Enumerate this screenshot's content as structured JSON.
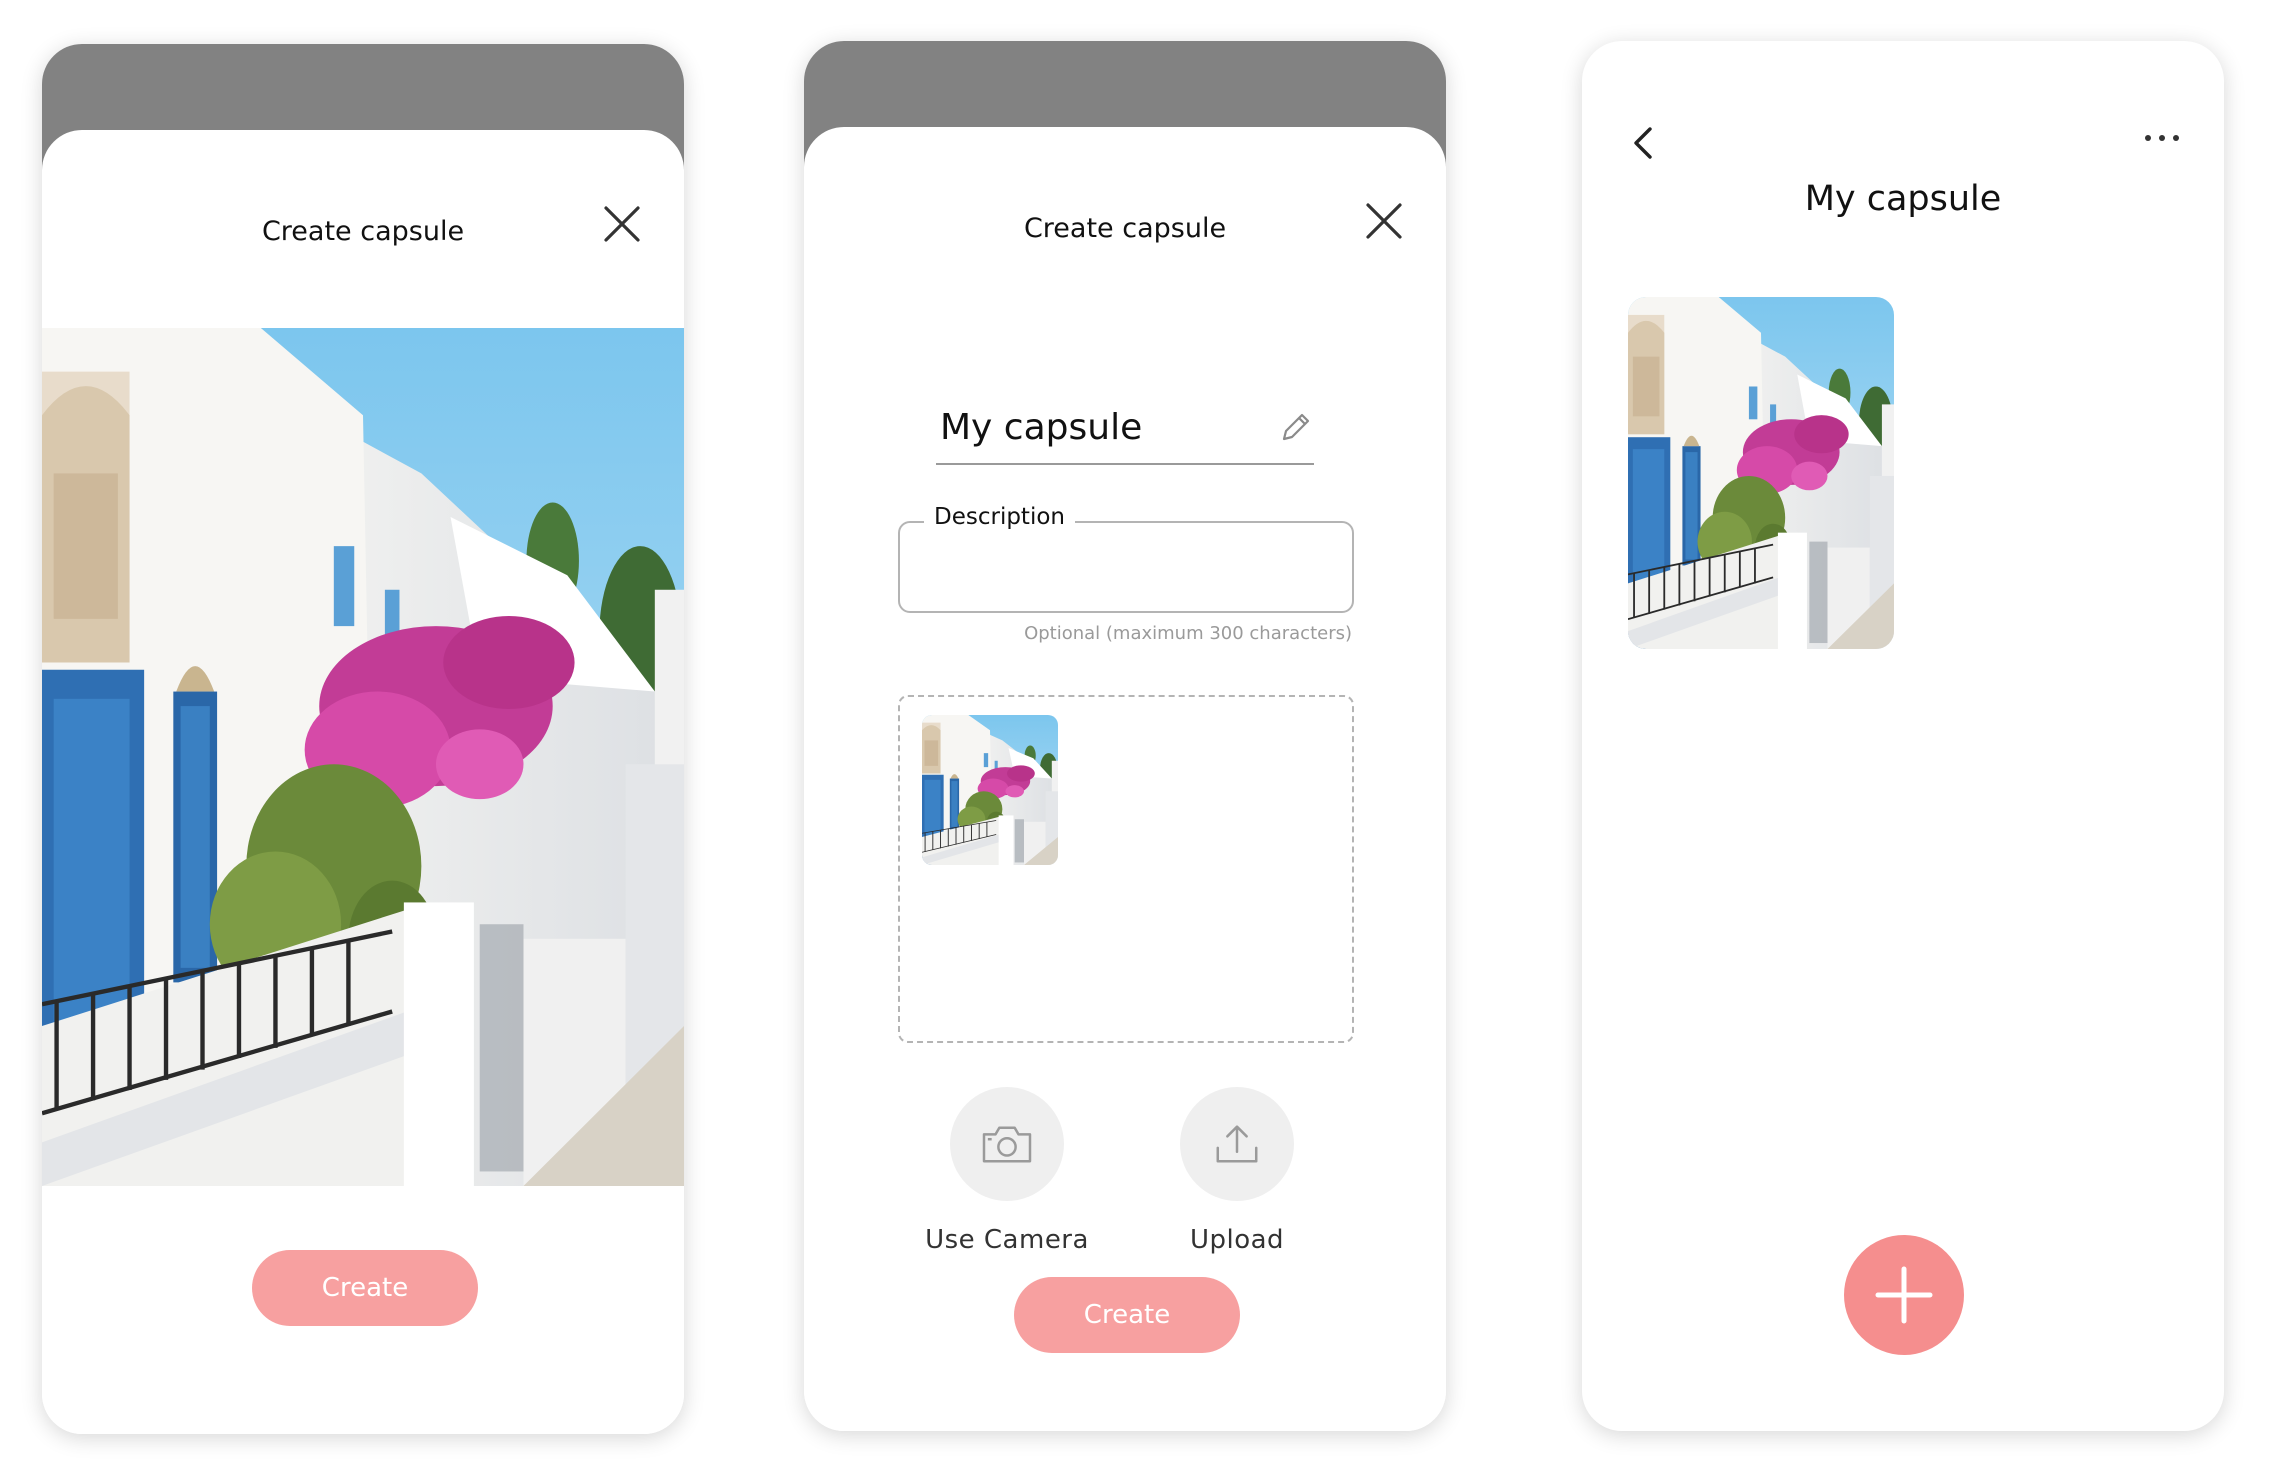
{
  "create_sheet": {
    "title": "Create capsule",
    "create_label": "Create"
  },
  "details_sheet": {
    "title": "Create capsule",
    "name_value": "My capsule",
    "description_label": "Description",
    "description_value": "",
    "description_hint": "Optional (maximum 300 characters)",
    "camera_label": "Use Camera",
    "upload_label": "Upload",
    "create_label": "Create"
  },
  "capsule_view": {
    "title": "My capsule"
  },
  "colors": {
    "create_button": "#f7a0a0",
    "fab": "#f58e8e",
    "sheet_backdrop": "#828282"
  },
  "icons": {
    "close": "close-icon",
    "edit": "pencil-icon",
    "camera": "camera-icon",
    "upload": "upload-icon",
    "back": "chevron-left-icon",
    "more": "more-dots-icon",
    "add": "plus-icon"
  }
}
